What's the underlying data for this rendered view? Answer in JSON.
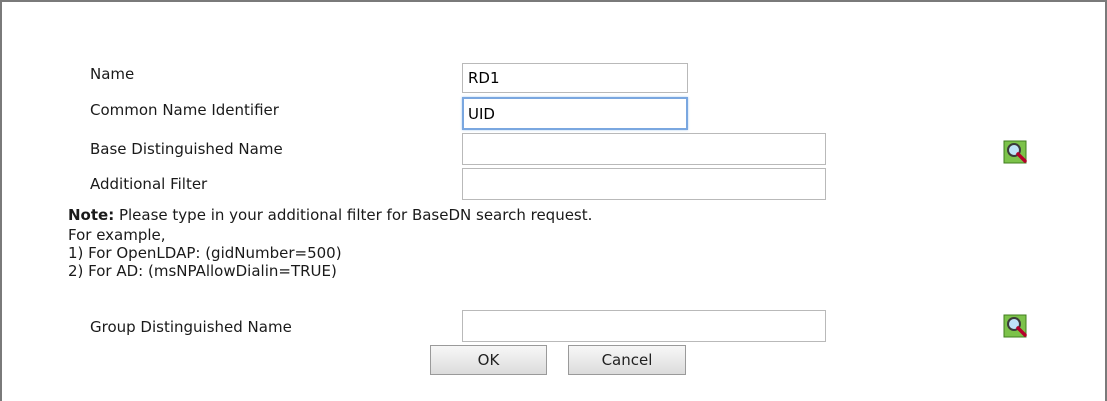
{
  "form": {
    "name": {
      "label": "Name",
      "value": "RD1"
    },
    "common_name_identifier": {
      "label": "Common Name Identifier",
      "value": "UID"
    },
    "base_dn": {
      "label": "Base Distinguished Name",
      "value": ""
    },
    "additional_filter": {
      "label": "Additional Filter",
      "value": ""
    },
    "group_dn": {
      "label": "Group Distinguished Name",
      "value": ""
    }
  },
  "note": {
    "title": "Note:",
    "text": " Please type in your additional filter for BaseDN search request.",
    "line2": "For example,",
    "line3": "1) For OpenLDAP: (gidNumber=500)",
    "line4": "2) For AD: (msNPAllowDialin=TRUE)"
  },
  "icons": {
    "search": "search-icon"
  },
  "buttons": {
    "ok": "OK",
    "cancel": "Cancel"
  }
}
